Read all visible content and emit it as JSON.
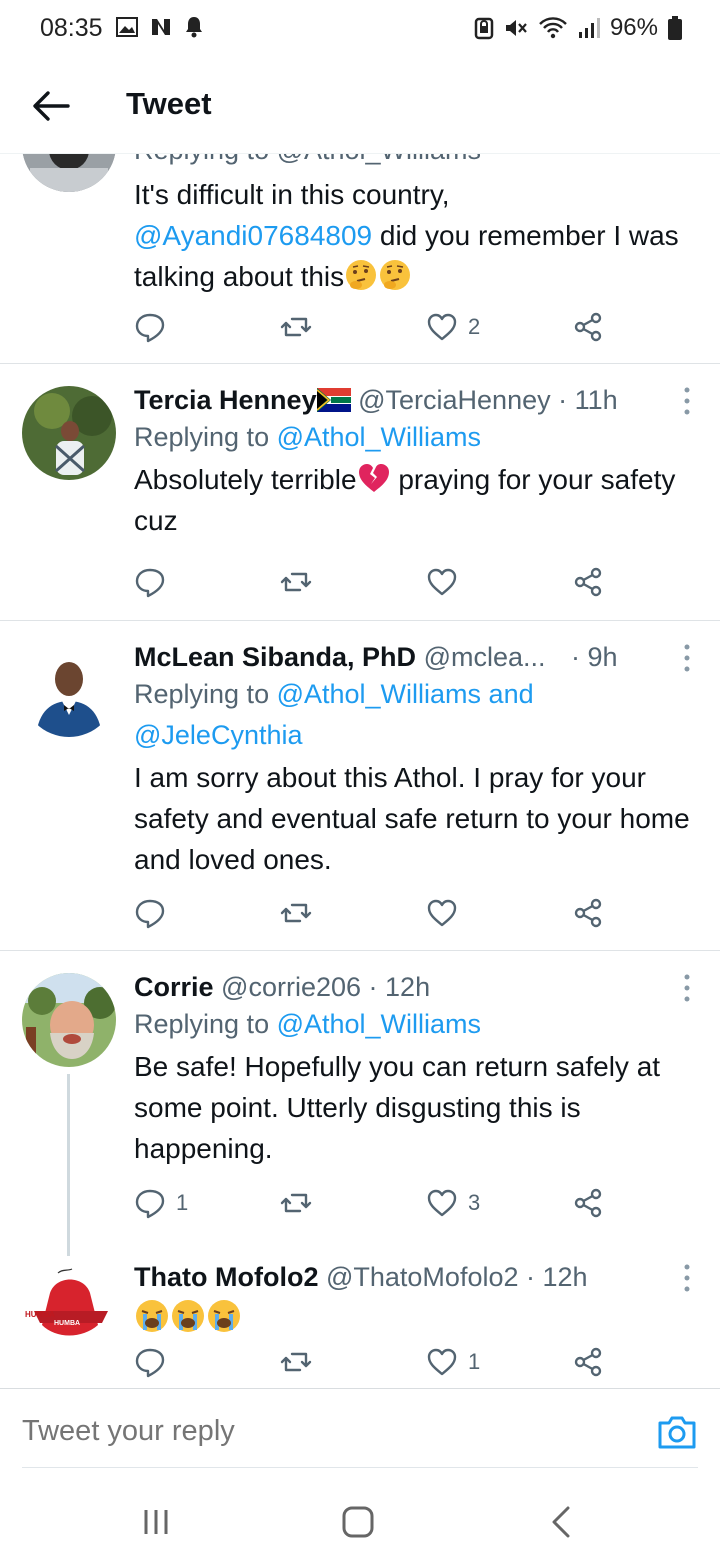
{
  "status_bar": {
    "time": "08:35",
    "battery": "96%"
  },
  "header": {
    "title": "Tweet"
  },
  "tweets": [
    {
      "partial_reply_line": "Replying to @Athol_Williams",
      "body_parts": [
        "It's difficult in this country, ",
        "@Ayandi07684809",
        " did you remember I was talking about this"
      ],
      "emojis": [
        "thinking-face",
        "thinking-face"
      ],
      "reply_count": "",
      "retweet_count": "",
      "like_count": "2"
    },
    {
      "name": "Tercia Henney",
      "flag": "south-africa-flag",
      "handle": "@TerciaHenney",
      "time": "· 11h",
      "replying_label": "Replying to ",
      "replying_to": "@Athol_Williams",
      "body_parts": [
        "Absolutely terrible",
        " praying for your safety cuz"
      ],
      "emojis": [
        "broken-heart"
      ],
      "reply_count": "",
      "retweet_count": "",
      "like_count": ""
    },
    {
      "name": "McLean Sibanda, PhD",
      "handle": "@mclea...",
      "time": "· 9h",
      "replying_label": "Replying to ",
      "replying_to": "@Athol_Williams and @JeleCynthia",
      "body": "I am sorry about this Athol. I pray for your safety and eventual safe return to your home and loved ones.",
      "reply_count": "",
      "retweet_count": "",
      "like_count": ""
    },
    {
      "name": "Corrie",
      "handle": "@corrie206",
      "time": "· 12h",
      "replying_label": "Replying to ",
      "replying_to": "@Athol_Williams",
      "body": "Be safe! Hopefully you can return safely at some point. Utterly disgusting this is happening.",
      "reply_count": "1",
      "retweet_count": "",
      "like_count": "3"
    },
    {
      "name": "Thato Mofolo2",
      "handle": "@ThatoMofolo2",
      "time": "· 12h",
      "emojis": [
        "loudly-crying-face",
        "loudly-crying-face",
        "loudly-crying-face"
      ],
      "avatar_text_1": "HUMBA",
      "avatar_text_2": "HUMBA",
      "reply_count": "",
      "retweet_count": "",
      "like_count": "1"
    }
  ],
  "reply_box": {
    "placeholder": "Tweet your reply"
  },
  "colors": {
    "link": "#1d9bf0",
    "secondary_text": "#536471",
    "primary_text": "#0f1419",
    "divider": "#dfe3e6"
  }
}
